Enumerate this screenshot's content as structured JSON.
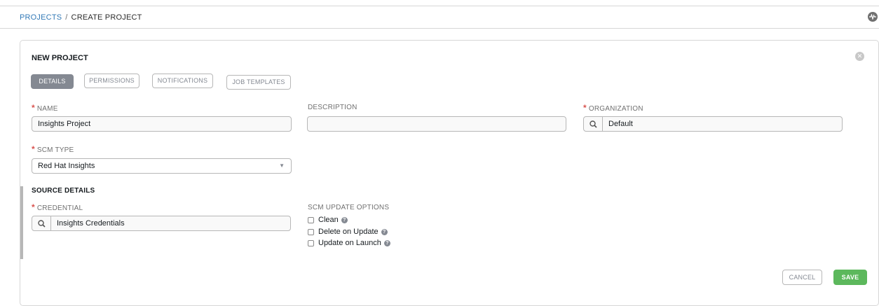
{
  "breadcrumb": {
    "root": "PROJECTS",
    "separator": "/",
    "current": "CREATE PROJECT"
  },
  "header": {
    "activity_icon": "activity-stream-icon"
  },
  "panel": {
    "title": "NEW PROJECT",
    "close_icon": "close-icon",
    "tabs": [
      {
        "label": "DETAILS",
        "active": true
      },
      {
        "label": "PERMISSIONS",
        "active": false
      },
      {
        "label": "NOTIFICATIONS",
        "active": false
      },
      {
        "label": "JOB TEMPLATES",
        "active": false
      }
    ]
  },
  "form": {
    "required_marker": "*",
    "name": {
      "label": "NAME",
      "value": "Insights Project",
      "required": true
    },
    "description": {
      "label": "DESCRIPTION",
      "value": "",
      "required": false
    },
    "organization": {
      "label": "ORGANIZATION",
      "value": "Default",
      "required": true
    },
    "scm_type": {
      "label": "SCM TYPE",
      "value": "Red Hat Insights",
      "required": true
    },
    "source_details": {
      "heading": "SOURCE DETAILS"
    },
    "credential": {
      "label": "CREDENTIAL",
      "value": "Insights Credentials",
      "required": true
    },
    "scm_update_options": {
      "label": "SCM UPDATE OPTIONS",
      "options": [
        {
          "label": "Clean",
          "checked": false
        },
        {
          "label": "Delete on Update",
          "checked": false
        },
        {
          "label": "Update on Launch",
          "checked": false
        }
      ]
    }
  },
  "actions": {
    "cancel_label": "CANCEL",
    "save_label": "SAVE"
  },
  "colors": {
    "accent_save": "#5cb85c",
    "required": "#d9534f",
    "link": "#337ab7",
    "active_tab": "#848992"
  }
}
